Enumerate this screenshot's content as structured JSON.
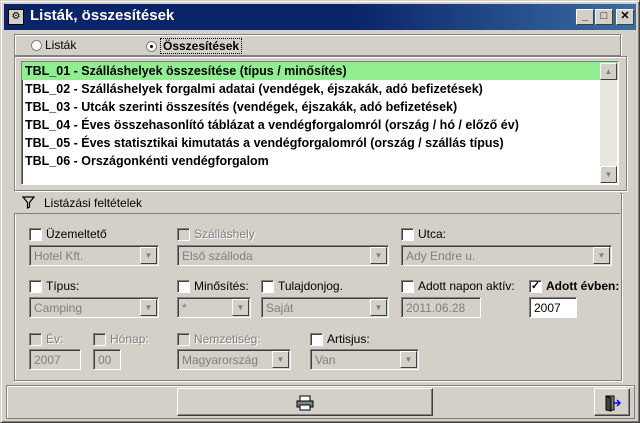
{
  "window": {
    "title": "Listák, összesítések"
  },
  "mode": {
    "option_lists": "Listák",
    "option_summaries": "Összesítések",
    "selected": "Összesítések"
  },
  "reports": [
    "TBL_01 - Szálláshelyek összesítése (típus / minősítés)",
    "TBL_02 - Szálláshelyek forgalmi adatai (vendégek, éjszakák, adó befizetések)",
    "TBL_03 - Utcák szerinti összesítés (vendégek, éjszakák, adó befizetések)",
    "TBL_04 - Éves összehasonlító táblázat a vendégforgalomról (ország / hó / előző év)",
    "TBL_05 - Éves statisztikai kimutatás a vendégforgalomról (ország / szállás típus)",
    "TBL_06 - Országonkénti vendégforgalom"
  ],
  "selected_report_index": 0,
  "filters": {
    "header": "Listázási feltételek",
    "operator": {
      "label": "Üzemeltető",
      "value": "Hotel Kft."
    },
    "accommodation": {
      "label": "Szálláshely",
      "value": "Első szálloda"
    },
    "street": {
      "label": "Utca:",
      "value": "Ady Endre u."
    },
    "type": {
      "label": "Típus:",
      "value": "Camping"
    },
    "rating": {
      "label": "Minősítés:",
      "value": "*"
    },
    "ownership": {
      "label": "Tulajdonjog.",
      "value": "Saját"
    },
    "active_on_date": {
      "label": "Adott napon aktív:",
      "value": "2011.06.28"
    },
    "year_given": {
      "label": "Adott évben:",
      "value": "2007",
      "checked": true
    },
    "year": {
      "label": "Év:",
      "value": "2007"
    },
    "month": {
      "label": "Hónap:",
      "value": "00"
    },
    "nationality": {
      "label": "Nemzetiség:",
      "value": "Magyarország"
    },
    "artisjus": {
      "label": "Artisjus:",
      "value": "Van"
    }
  },
  "icons": {
    "app": "app-icon",
    "print": "printer-icon",
    "exit": "exit-door-icon",
    "filter": "funnel-icon"
  }
}
